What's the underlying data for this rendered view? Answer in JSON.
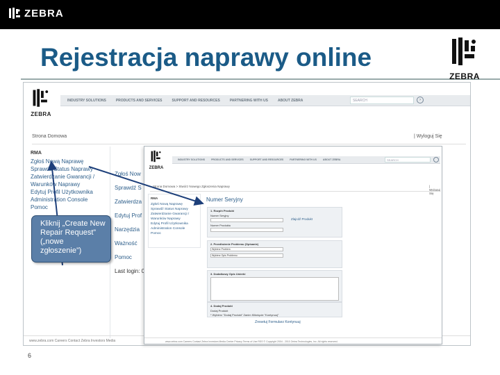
{
  "top_bar": {
    "brand": "ZEBRA"
  },
  "slide": {
    "title": "Rejestracja naprawy online",
    "logo_word": "ZEBRA",
    "page_number": "6",
    "callout": "Kliknij „Create New Repair Request” („nowe zgłoszenie”)"
  },
  "shot1": {
    "logo_word": "ZEBRA",
    "nav": [
      "INDUSTRY SOLUTIONS",
      "PRODUCTS AND SERVICES",
      "SUPPORT AND RESOURCES",
      "PARTNERING WITH US",
      "ABOUT ZEBRA"
    ],
    "search_placeholder": "SEARCH",
    "breadcrumb": "Strona Domowa",
    "logout": "| Wyloguj Się",
    "sidebar_header": "RMA",
    "sidebar": [
      "Zgłoś Nową Naprawę",
      "Sprawdź Status Naprawy",
      "Zatwierdzanie Gwarancji /",
      "Warunków Naprawy",
      "Edytuj Profil Użytkownika",
      "Administration Console",
      "Pomoc"
    ],
    "col2": [
      "Zgłoś Now",
      "Sprawdź S",
      "Zatwierdza",
      "Edytuj Prof",
      "Narzędzia",
      "Ważność",
      "Pomoc",
      "Last login: 0"
    ],
    "footer": "www.zebra.com  Careers  Contact Zebra  Investors  Media"
  },
  "shot2": {
    "logo_word": "ZEBRA",
    "nav": [
      "INDUSTRY SOLUTIONS",
      "PRODUCTS AND SERVICES",
      "SUPPORT AND RESOURCES",
      "PARTNERING WITH US",
      "ABOUT ZEBRA"
    ],
    "search_placeholder": "SEARCH",
    "breadcrumb": "Strona Domowa > Stwórz Nowego Zgłoszenia Naprawy",
    "logout": "| Wyloguj Się",
    "sidebar_header": "RMA",
    "sidebar": [
      "Zgłoś Nową Naprawę",
      "Sprawdź Status Naprawy",
      "Zatwierdzanie Gwarancji /",
      "Warunków Naprawy",
      "Edytuj Profil Użytkownika",
      "Administration Console",
      "Pomoc"
    ],
    "page_title": "Numer Seryjny",
    "sec1_title": "1. Rozpiń Produkt",
    "sec1_field1": "Numer Seryjny",
    "sec1_field2": "Numer Produktu",
    "sec1_link": "Zlajcdź Produkt",
    "sec2_title": "2. Przedłożenie Problemu (Opisanie)",
    "sec2_select1": "Wybierz Problem",
    "sec2_select2": "Wybierz Opis Problemu",
    "sec3_title": "3. Dodatkowy Opis Usterki",
    "sec4_title": "4. Dodaj Produkt",
    "sec4_opt": "Dodaj Produkt",
    "sec4_note": "* Wybierz \"Dodaj Produkt\" Zanim Kliknięcie \"Kontynuuj\"",
    "bottom_links": "Zresetuj Formularz   Kontynuuj",
    "footer": "www.zebra.com  Careers  Contact Zebra  Investors  Media Center  Privacy  Terms of Use  RSS        © Copyright 2004 - 2010 Zebra Technologies, Inc. All rights reserved."
  }
}
